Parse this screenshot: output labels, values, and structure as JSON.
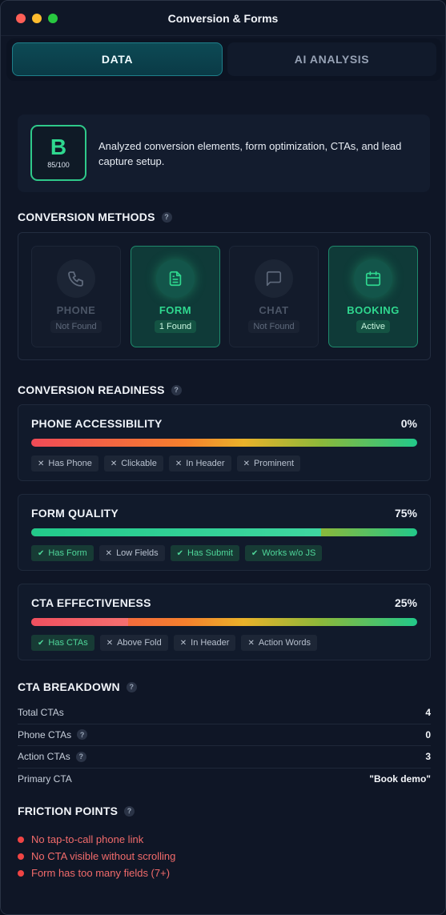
{
  "window": {
    "title": "Conversion & Forms"
  },
  "tabs": [
    {
      "label": "DATA",
      "active": true
    },
    {
      "label": "AI ANALYSIS",
      "active": false
    }
  ],
  "grade": {
    "letter": "B",
    "score": "85/100",
    "description": "Analyzed conversion elements, form optimization, CTAs, and lead capture setup."
  },
  "sections": {
    "methods": "CONVERSION METHODS",
    "readiness": "CONVERSION READINESS",
    "cta": "CTA BREAKDOWN",
    "friction": "FRICTION POINTS",
    "help": "?"
  },
  "methods": [
    {
      "label": "PHONE",
      "status": "Not Found",
      "state": "off",
      "icon": "phone-icon"
    },
    {
      "label": "FORM",
      "status": "1 Found",
      "state": "on",
      "icon": "form-icon"
    },
    {
      "label": "CHAT",
      "status": "Not Found",
      "state": "off",
      "icon": "chat-icon"
    },
    {
      "label": "BOOKING",
      "status": "Active",
      "state": "on",
      "icon": "calendar-icon"
    }
  ],
  "metrics": [
    {
      "name": "PHONE ACCESSIBILITY",
      "value": "0%",
      "percent": 0,
      "checks": [
        {
          "label": "Has Phone",
          "ok": false
        },
        {
          "label": "Clickable",
          "ok": false
        },
        {
          "label": "In Header",
          "ok": false
        },
        {
          "label": "Prominent",
          "ok": false
        }
      ]
    },
    {
      "name": "FORM QUALITY",
      "value": "75%",
      "percent": 75,
      "checks": [
        {
          "label": "Has Form",
          "ok": true
        },
        {
          "label": "Low Fields",
          "ok": false
        },
        {
          "label": "Has Submit",
          "ok": true
        },
        {
          "label": "Works w/o JS",
          "ok": true
        }
      ]
    },
    {
      "name": "CTA EFFECTIVENESS",
      "value": "25%",
      "percent": 25,
      "checks": [
        {
          "label": "Has CTAs",
          "ok": true
        },
        {
          "label": "Above Fold",
          "ok": false
        },
        {
          "label": "In Header",
          "ok": false
        },
        {
          "label": "Action Words",
          "ok": false
        }
      ]
    }
  ],
  "cta_breakdown": [
    {
      "label": "Total CTAs",
      "value": "4",
      "help": false
    },
    {
      "label": "Phone CTAs",
      "value": "0",
      "help": true
    },
    {
      "label": "Action CTAs",
      "value": "3",
      "help": true
    },
    {
      "label": "Primary CTA",
      "value": "\"Book demo\"",
      "help": false
    }
  ],
  "friction_points": [
    "No tap-to-call phone link",
    "No CTA visible without scrolling",
    "Form has too many fields (7+)"
  ],
  "colors": {
    "accent_green": "#2fd88f",
    "danger_red": "#ef4444",
    "tab_active": "#0d4a55"
  }
}
